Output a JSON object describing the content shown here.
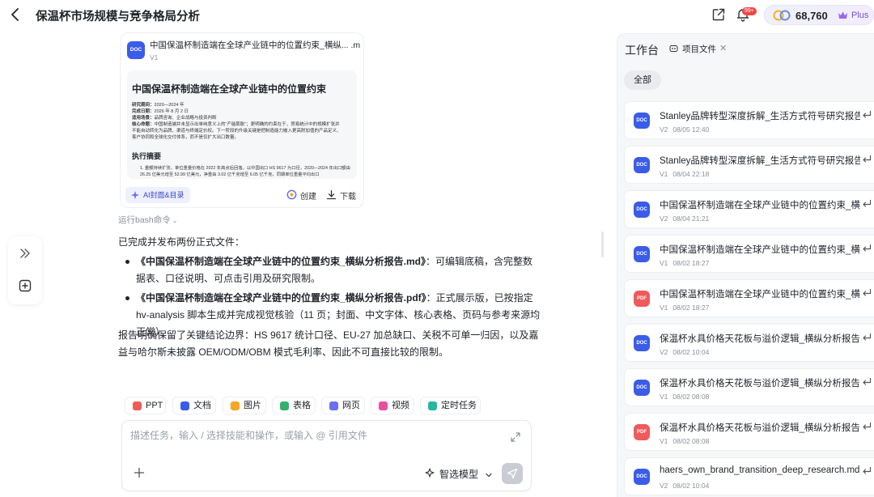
{
  "header": {
    "title": "保温杯市场规模与竞争格局分析",
    "notification_badge": "99+",
    "credits": "68,760",
    "plan": "Plus"
  },
  "doc_card": {
    "type": "DOC",
    "title": "中国保温杯制造端在全球产业链中的位置约束_横纵... .md",
    "version": "V1",
    "preview": {
      "title": "中国保温杯制造端在全球产业链中的位置约束",
      "meta": [
        {
          "label": "研究期间：",
          "value": "2020—2024 年"
        },
        {
          "label": "完成日期：",
          "value": "2026 年 8 月 2 日"
        },
        {
          "label": "适用场景：",
          "value": "品牌咨询、企业战略与投资判断"
        },
        {
          "label": "核心命题：",
          "value": "中国制造端并未显示出单纯意义上的“产能膨胀”；更明确的约束在于，贸易统计中的规模扩张并"
        },
        {
          "label": "",
          "value": "不能自动转化为品牌、渠道与终端定价权。下一阶段的升级关键是把制造能力嵌入更高附加值的产品定义、"
        },
        {
          "label": "",
          "value": "客户协同和全球化交付体系，而不是仅扩大出口数量。"
        }
      ],
      "section": "执行摘要",
      "item": "1. 量额持续扩张，单位重量价格在 2022 年高点后回落。以中国出口 HS 9617 为口径，2020—2024 年出口额由 26.25 亿美元增至 52.99 亿美元，净重由 3.02 亿千克增至 6.05 亿千克，同期单位重量平均出口"
    },
    "ai_button": "AI封面&目录",
    "create_button": "创建",
    "download_button": "下载"
  },
  "message": {
    "bash_toggle": "运行bash命令",
    "intro": "已完成并发布两份正式文件：",
    "bullets": [
      {
        "bold": "《中国保温杯制造端在全球产业链中的位置约束_横纵分析报告.md》",
        "text": "：可编辑底稿，含完整数据表、口径说明、可点击引用及研究限制。"
      },
      {
        "bold": "《中国保温杯制造端在全球产业链中的位置约束_横纵分析报告.pdf》",
        "text": "：正式展示版，已按指定 hv-analysis 脚本生成并完成视觉核验（11 页；封面、中文字体、核心表格、页码与参考来源均正常）。"
      }
    ],
    "summary": "报告明确保留了关键结论边界：HS 9617 统计口径、EU-27 加总缺口、关税不可单一归因，以及嘉益与哈尔斯未披露 OEM/ODM/OBM 模式毛利率、因此不可直接比较的限制。"
  },
  "quick_tools": [
    {
      "label": "PPT",
      "color": "#f05a5a"
    },
    {
      "label": "文档",
      "color": "#3a5ce8"
    },
    {
      "label": "图片",
      "color": "#f5a623"
    },
    {
      "label": "表格",
      "color": "#2fb36b"
    },
    {
      "label": "网页",
      "color": "#6b6ff0"
    },
    {
      "label": "视频",
      "color": "#e84fa3"
    },
    {
      "label": "定时任务",
      "color": "#22b8a0"
    }
  ],
  "input": {
    "placeholder": "描述任务，输入 / 选择技能和操作，或输入 @ 引用文件",
    "model": "智选模型"
  },
  "workspace": {
    "title": "工作台",
    "tab": "项目文件",
    "filter": "全部",
    "files": [
      {
        "type": "DOC",
        "name": "Stanley品牌转型深度拆解_生活方式符号研究报告...",
        "version": "V2",
        "date": "08/05 12:40"
      },
      {
        "type": "DOC",
        "name": "Stanley品牌转型深度拆解_生活方式符号研究报告...",
        "version": "V1",
        "date": "08/04 22:18"
      },
      {
        "type": "DOC",
        "name": "中国保温杯制造端在全球产业链中的位置约束_横...",
        "version": "V2",
        "date": "08/04 21:21"
      },
      {
        "type": "DOC",
        "name": "中国保温杯制造端在全球产业链中的位置约束_横...",
        "version": "V1",
        "date": "08/02 18:27"
      },
      {
        "type": "PDF",
        "name": "中国保温杯制造端在全球产业链中的位置约束_横...",
        "version": "V1",
        "date": "08/02 18:27"
      },
      {
        "type": "DOC",
        "name": "保温杯水具价格天花板与溢价逻辑_横纵分析报告....",
        "version": "V2",
        "date": "08/02 10:04"
      },
      {
        "type": "DOC",
        "name": "保温杯水具价格天花板与溢价逻辑_横纵分析报告....",
        "version": "V1",
        "date": "08/02 08:08"
      },
      {
        "type": "PDF",
        "name": "保温杯水具价格天花板与溢价逻辑_横纵分析报告....",
        "version": "V1",
        "date": "08/02 08:08"
      },
      {
        "type": "DOC",
        "name": "haers_own_brand_transition_deep_research.md",
        "version": "V2",
        "date": "08/02 10:04"
      }
    ]
  }
}
